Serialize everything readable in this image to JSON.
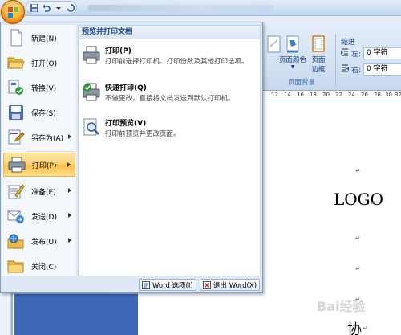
{
  "menu": {
    "items": [
      {
        "label": "新建(N)",
        "icon": "new-document-icon"
      },
      {
        "label": "打开(O)",
        "icon": "open-folder-icon"
      },
      {
        "label": "转换(V)",
        "icon": "convert-icon"
      },
      {
        "label": "保存(S)",
        "icon": "save-icon"
      },
      {
        "label": "另存为(A)",
        "icon": "save-as-icon"
      },
      {
        "label": "打印(P)",
        "icon": "printer-icon"
      },
      {
        "label": "准备(E)",
        "icon": "prepare-icon"
      },
      {
        "label": "发送(D)",
        "icon": "send-icon"
      },
      {
        "label": "发布(U)",
        "icon": "publish-icon"
      },
      {
        "label": "关闭(C)",
        "icon": "close-folder-icon"
      }
    ],
    "submenu": {
      "header": "预览并打印文档",
      "items": [
        {
          "title": "打印(P)",
          "desc": "打印前选择打印机、打印份数及其他打印选项。"
        },
        {
          "title": "快速打印(Q)",
          "desc": "不做更改，直接将文档发送到默认打印机。"
        },
        {
          "title": "打印预览(V)",
          "desc": "打印前预览并更改页面。"
        }
      ]
    },
    "word_options": "Word 选项(I)",
    "exit_word": "退出 Word(X)"
  },
  "ribbon": {
    "page_color": "页面颜色",
    "page_border": "页面\n边框",
    "page_border_l1": "页面",
    "page_border_l2": "边框",
    "page_background_group": "页面背景",
    "indent": {
      "heading": "缩进",
      "left_label": "左:",
      "left_value": "0 字符",
      "right_label": "右:",
      "right_value": "0 字符"
    }
  },
  "ruler": [
    "12",
    "14",
    "16",
    "18",
    "20",
    "22",
    "24",
    "26",
    "28",
    "30",
    "32"
  ],
  "document": {
    "logo": "LOGO",
    "char": "协",
    "watermark": "Bai经验"
  },
  "colors": {
    "accent": "#ffc248",
    "ribbon": "#d2e0f2",
    "menu_bg": "#dfe8f5"
  }
}
